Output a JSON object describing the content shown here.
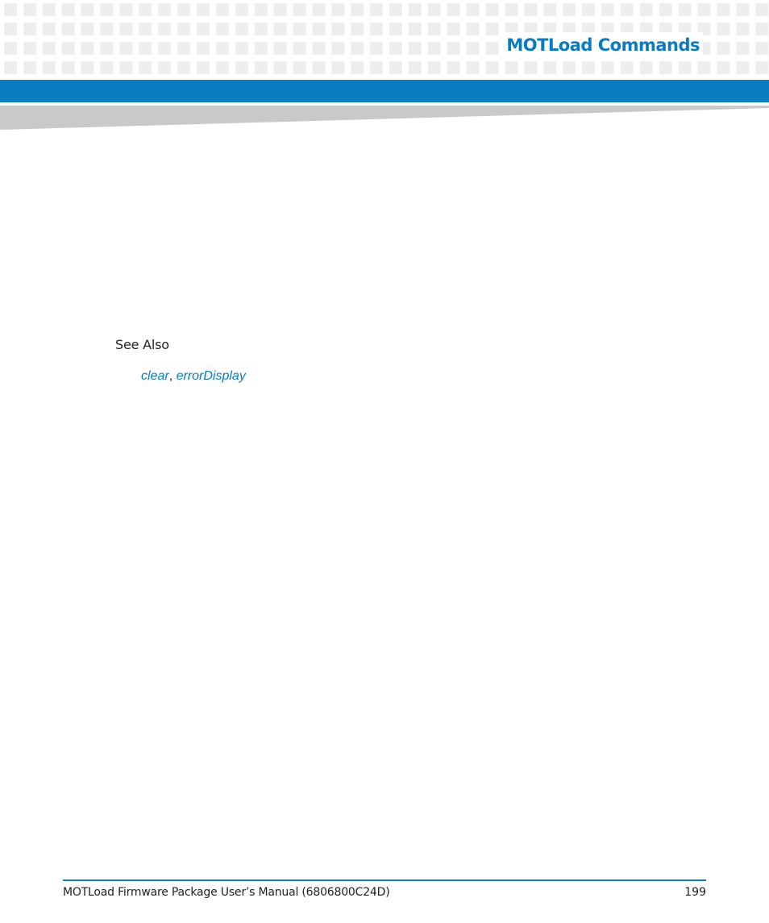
{
  "header": {
    "section_title": "MOTLoad Commands"
  },
  "content": {
    "see_also_heading": "See Also",
    "links": [
      {
        "label": "clear"
      },
      {
        "label": "errorDisplay"
      }
    ],
    "separator": ", "
  },
  "footer": {
    "manual_title": "MOTLoad Firmware Package User’s Manual (6806800C24D)",
    "page_number": "199"
  },
  "colors": {
    "accent_blue": "#0a7dc1",
    "grid_grey": "#eeeeef",
    "wedge_grey": "#c8c9cb"
  }
}
